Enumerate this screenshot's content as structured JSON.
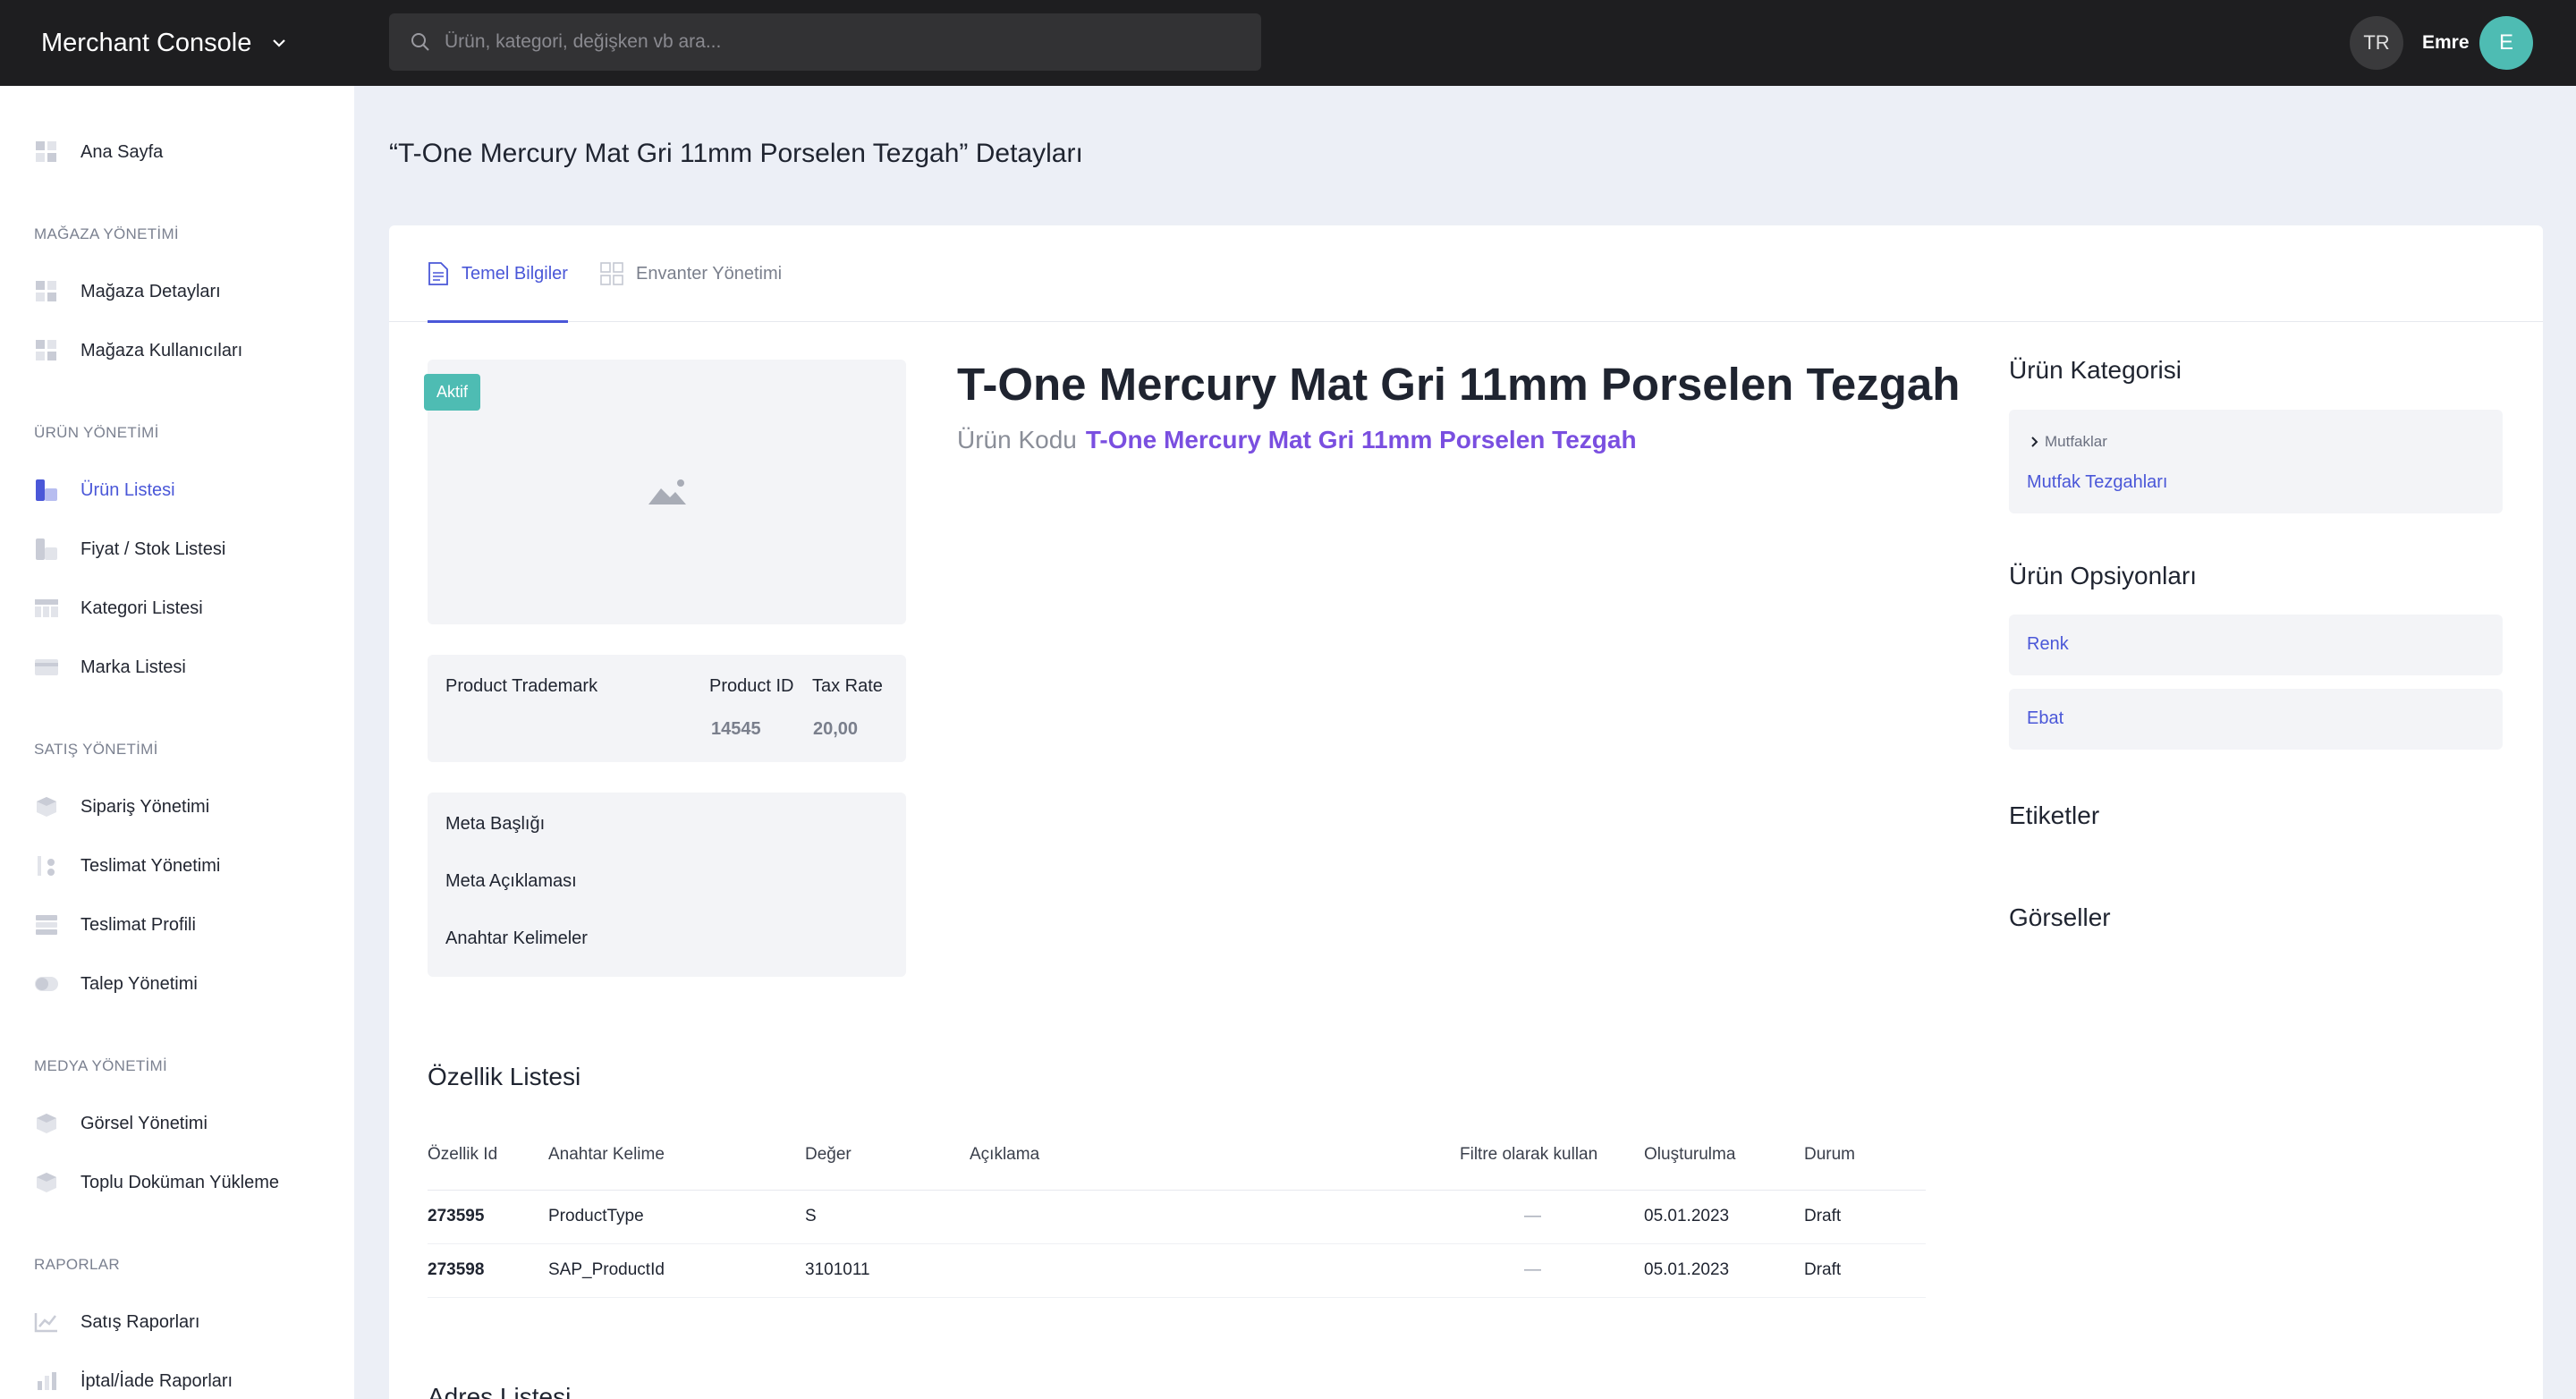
{
  "header": {
    "brand": "Merchant Console",
    "search_placeholder": "Ürün, kategori, değişken vb ara...",
    "language": "TR",
    "user_name": "Emre",
    "avatar_initial": "E"
  },
  "sidebar": {
    "home": "Ana Sayfa",
    "sections": {
      "store": "MAĞAZA YÖNETİMİ",
      "product": "ÜRÜN YÖNETİMİ",
      "sales": "SATIŞ YÖNETİMİ",
      "media": "MEDYA YÖNETİMİ",
      "reports": "RAPORLAR"
    },
    "items": {
      "store_details": "Mağaza Detayları",
      "store_users": "Mağaza Kullanıcıları",
      "product_list": "Ürün Listesi",
      "price_stock": "Fiyat / Stok Listesi",
      "category_list": "Kategori Listesi",
      "brand_list": "Marka Listesi",
      "order_mgmt": "Sipariş Yönetimi",
      "delivery_mgmt": "Teslimat Yönetimi",
      "delivery_profile": "Teslimat Profili",
      "request_mgmt": "Talep Yönetimi",
      "image_mgmt": "Görsel Yönetimi",
      "bulk_upload": "Toplu Doküman Yükleme",
      "sales_reports": "Satış Raporları",
      "return_reports": "İptal/İade Raporları"
    }
  },
  "page": {
    "title": "“T-One Mercury Mat Gri 11mm Porselen Tezgah” Detayları",
    "tabs": [
      "Temel Bilgiler",
      "Envanter Yönetimi"
    ],
    "status_badge": "Aktif",
    "info": {
      "trademark_label": "Product Trademark",
      "product_id_label": "Product ID",
      "product_id_value": "14545",
      "tax_label": "Tax Rate",
      "tax_value": "20,00"
    },
    "meta": {
      "title_label": "Meta Başlığı",
      "description_label": "Meta Açıklaması",
      "keywords_label": "Anahtar Kelimeler"
    },
    "product_title": "T-One Mercury Mat Gri 11mm Porselen Tezgah",
    "product_code_label": "Ürün Kodu",
    "product_code_value": "T-One Mercury Mat Gri 11mm Porselen Tezgah",
    "right": {
      "category_title": "Ürün Kategorisi",
      "category_parent": "Mutfaklar",
      "category_child": "Mutfak Tezgahları",
      "options_title": "Ürün Opsiyonları",
      "options": [
        "Renk",
        "Ebat"
      ],
      "tags_title": "Etiketler",
      "images_title": "Görseller"
    },
    "features": {
      "title": "Özellik Listesi",
      "columns": [
        "Özellik Id",
        "Anahtar Kelime",
        "Değer",
        "Açıklama",
        "Filtre olarak kullan",
        "Oluşturulma",
        "Durum"
      ],
      "rows": [
        {
          "id": "273595",
          "keyword": "ProductType",
          "value": "S",
          "description": "",
          "filter": "—",
          "created": "05.01.2023",
          "status": "Draft"
        },
        {
          "id": "273598",
          "keyword": "SAP_ProductId",
          "value": "3101011",
          "description": "",
          "filter": "—",
          "created": "05.01.2023",
          "status": "Draft"
        }
      ]
    },
    "address_title": "Adres Listesi"
  }
}
